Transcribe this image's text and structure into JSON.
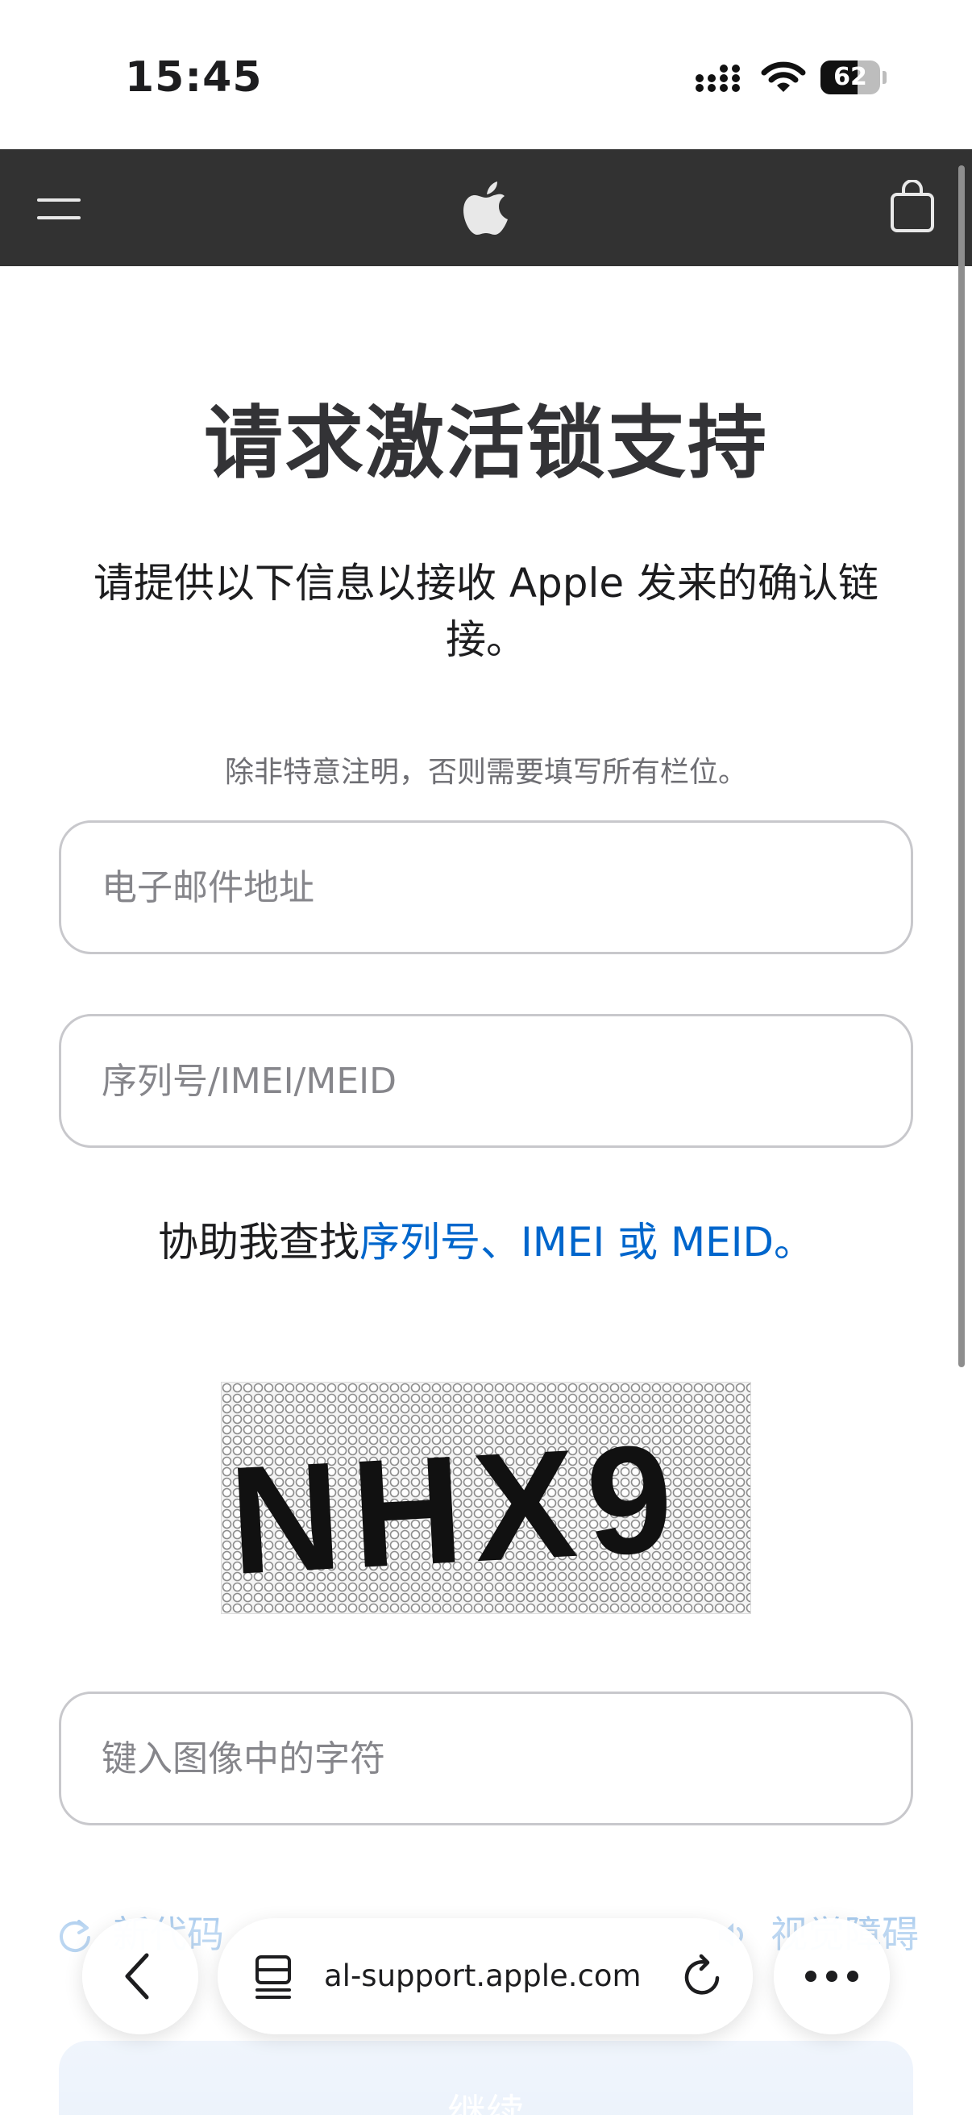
{
  "status_bar": {
    "time": "15:45",
    "battery_level": "62",
    "battery_fraction": 0.62
  },
  "nav": {
    "menu_icon": "hamburger-icon",
    "logo_icon": "apple-logo-icon",
    "bag_icon": "shopping-bag-icon",
    "background_color": "#323232"
  },
  "form": {
    "title": "请求激活锁支持",
    "intro": "请提供以下信息以接收 Apple 发来的确认链接。",
    "required_note": "除非特意注明，否则需要填写所有栏位。",
    "email_placeholder": "电子邮件地址",
    "serial_placeholder": "序列号/IMEI/MEID",
    "help_prefix": "协助我查找",
    "help_link": "序列号、IMEI 或 MEID。",
    "captcha_text": "NHX9",
    "captcha_placeholder": "键入图像中的字符",
    "refresh_label": "新代码",
    "audio_label": "视觉障碍",
    "continue_label": "继续",
    "link_color": "#0066cc"
  },
  "browser": {
    "address": "al-support.apple.com",
    "back_icon": "chevron-left-icon",
    "page_menu_icon": "page-menu-icon",
    "reload_icon": "reload-icon",
    "more_icon": "more-ellipsis-icon"
  }
}
